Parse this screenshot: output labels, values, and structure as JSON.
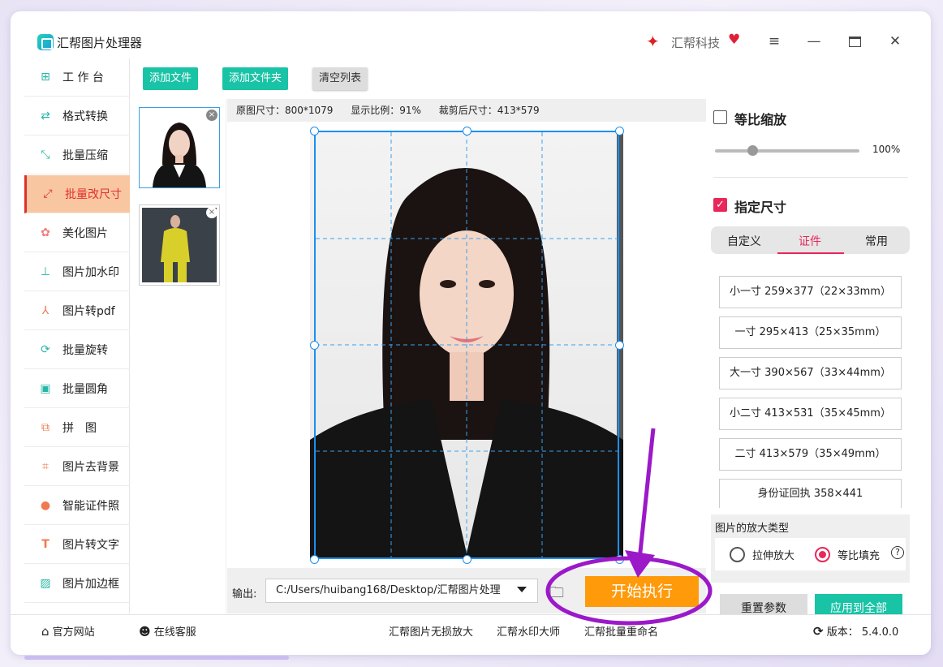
{
  "window": {
    "title": "汇帮图片处理器",
    "brand": "汇帮科技",
    "menu_icon": "hamburger-icon",
    "controls": [
      "minimize-icon",
      "maximize-icon",
      "close-icon"
    ]
  },
  "sidebar": {
    "items": [
      {
        "label": "工 作 台",
        "icon": "grid-icon"
      },
      {
        "label": "格式转换",
        "icon": "convert-icon"
      },
      {
        "label": "批量压缩",
        "icon": "compress-icon"
      },
      {
        "label": "批量改尺寸",
        "icon": "resize-icon",
        "active": true
      },
      {
        "label": "美化图片",
        "icon": "beautify-icon"
      },
      {
        "label": "图片加水印",
        "icon": "watermark-icon"
      },
      {
        "label": "图片转pdf",
        "icon": "pdf-icon"
      },
      {
        "label": "批量旋转",
        "icon": "rotate-icon"
      },
      {
        "label": "批量圆角",
        "icon": "round-corner-icon"
      },
      {
        "label": "拼　图",
        "icon": "collage-icon"
      },
      {
        "label": "图片去背景",
        "icon": "crop-icon"
      },
      {
        "label": "智能证件照",
        "icon": "person-icon"
      },
      {
        "label": "图片转文字",
        "icon": "text-icon"
      },
      {
        "label": "图片加边框",
        "icon": "frame-icon"
      }
    ]
  },
  "toolbar": {
    "add_file": "添加文件",
    "add_folder": "添加文件夹",
    "clear_list": "清空列表"
  },
  "info": {
    "original_size": "原图尺寸：800*1079",
    "display_ratio": "显示比例：91%",
    "cropped_size": "裁剪后尺寸：413*579"
  },
  "output": {
    "label": "输出:",
    "path": "C:/Users/huibang168/Desktop/汇帮图片处理",
    "start": "开始执行"
  },
  "right_panel": {
    "proportional_label": "等比缩放",
    "proportional_checked": false,
    "slider_value": "100%",
    "slider_fraction": 0.25,
    "specify_label": "指定尺寸",
    "specify_checked": true,
    "tabs": [
      "自定义",
      "证件",
      "常用"
    ],
    "active_tab": "证件",
    "sizes": [
      "小一寸 259×377（22×33mm）",
      "一寸 295×413（25×35mm）",
      "大一寸 390×567（33×44mm）",
      "小二寸 413×531（35×45mm）",
      "二寸 413×579（35×49mm）",
      "身份证回执 358×441"
    ],
    "scale_type_title": "图片的放大类型",
    "scale_options": [
      "拉伸放大",
      "等比填充"
    ],
    "scale_selected": "等比填充",
    "reset": "重置参数",
    "apply_all": "应用到全部"
  },
  "footer": {
    "official_site": "官方网站",
    "online_service": "在线客服",
    "link1": "汇帮图片无损放大",
    "link2": "汇帮水印大师",
    "link3": "汇帮批量重命名",
    "version": "版本：  5.4.0.0"
  },
  "colors": {
    "accent": "#19c3a6",
    "active_red": "#e0302a",
    "start_orange": "#ff9a0a",
    "annotation_purple": "#9b19c9"
  }
}
